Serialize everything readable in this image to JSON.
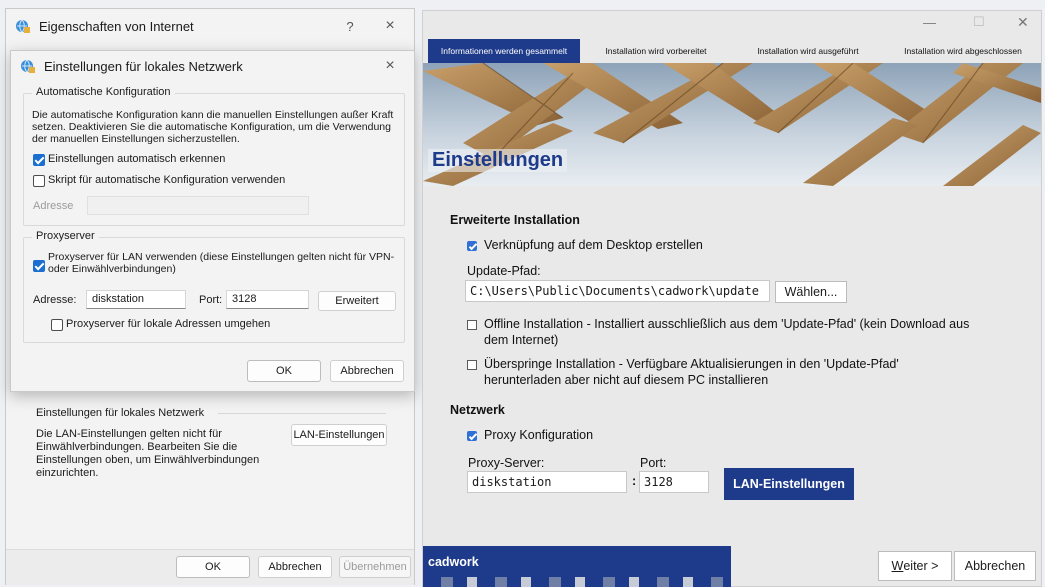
{
  "ie": {
    "title": "Eigenschaften von Internet",
    "help": "?",
    "close": "×",
    "lan_section_label": "Einstellungen für lokales Netzwerk",
    "lan_section_text": "Die LAN-Einstellungen gelten nicht für Einwählverbindungen. Bearbeiten Sie die Einstellungen oben, um Einwählverbindungen einzurichten.",
    "lan_button": "LAN-Einstellungen",
    "ok": "OK",
    "cancel": "Abbrechen",
    "apply": "Übernehmen"
  },
  "lan": {
    "title": "Einstellungen für lokales Netzwerk",
    "close": "×",
    "auto_group": "Automatische Konfiguration",
    "auto_desc": "Die automatische Konfiguration kann die manuellen Einstellungen außer Kraft setzen. Deaktivieren Sie die automatische Konfiguration, um die Verwendung der manuellen Einstellungen sicherzustellen.",
    "auto_detect": "Einstellungen automatisch erkennen",
    "auto_detect_checked": true,
    "script": "Skript für automatische Konfiguration verwenden",
    "script_checked": false,
    "address_label": "Adresse",
    "address_value": "",
    "proxy_group": "Proxyserver",
    "proxy_use": "Proxyserver für LAN verwenden (diese Einstellungen gelten nicht für VPN- oder Einwählverbindungen)",
    "proxy_use_checked": true,
    "proxy_address_label": "Adresse:",
    "proxy_address_value": "diskstation",
    "proxy_port_label": "Port:",
    "proxy_port_value": "3128",
    "advanced": "Erweitert",
    "bypass": "Proxyserver für lokale Adressen umgehen",
    "bypass_checked": false,
    "ok": "OK",
    "cancel": "Abbrechen"
  },
  "cadwork": {
    "min": "—",
    "max": "☐",
    "close": "✕",
    "tabs": [
      "Informationen werden gesammelt",
      "Installation wird vorbereitet",
      "Installation wird ausgeführt",
      "Installation wird abgeschlossen"
    ],
    "active_tab": 0,
    "banner_title": "Einstellungen",
    "adv_heading": "Erweiterte Installation",
    "desktop_shortcut": "Verknüpfung auf dem Desktop erstellen",
    "desktop_shortcut_checked": true,
    "update_path_label": "Update-Pfad:",
    "update_path_value": "C:\\Users\\Public\\Documents\\cadwork\\update",
    "choose": "Wählen...",
    "offline": "Offline Installation - Installiert ausschließlich aus dem 'Update-Pfad' (kein Download aus dem Internet)",
    "offline_checked": false,
    "skip": "Überspringe Installation - Verfügbare Aktualisierungen in den 'Update-Pfad' herunterladen aber nicht auf diesem PC installieren",
    "skip_checked": false,
    "net_heading": "Netzwerk",
    "proxy_config": "Proxy Konfiguration",
    "proxy_config_checked": true,
    "proxy_server_label": "Proxy-Server:",
    "proxy_server_value": "diskstation",
    "port_label": "Port:",
    "port_value": "3128",
    "colon": ":",
    "lan_settings": "LAN-Einstellungen",
    "brand": "cadwork",
    "next": "Weiter >",
    "cancel": "Abbrechen",
    "accent": "#1e3a8a"
  }
}
